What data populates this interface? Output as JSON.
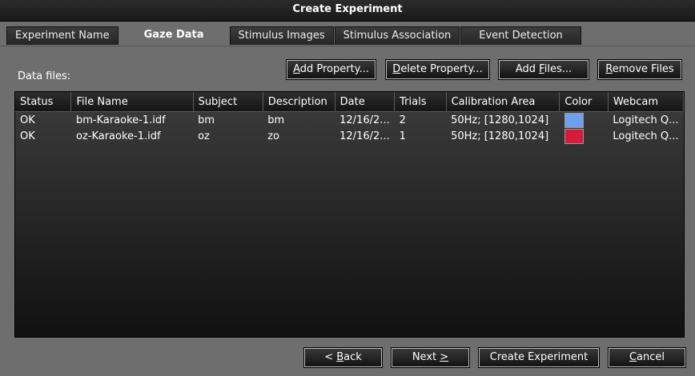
{
  "window": {
    "title": "Create Experiment"
  },
  "tabs": [
    {
      "label": "Experiment Name",
      "active": false
    },
    {
      "label": "Gaze Data",
      "active": true
    },
    {
      "label": "Stimulus Images",
      "active": false
    },
    {
      "label": "Stimulus Association",
      "active": false
    },
    {
      "label": "Event Detection",
      "active": false
    }
  ],
  "toolbar": {
    "add_property": {
      "u": "A",
      "rest": "dd Property..."
    },
    "delete_property": {
      "u": "D",
      "rest": "elete Property..."
    },
    "add_files": {
      "pre": "Add ",
      "u": "F",
      "rest": "iles..."
    },
    "remove_files": {
      "u": "R",
      "rest": "emove Files"
    }
  },
  "data_files_label": "Data files:",
  "table": {
    "columns": [
      "Status",
      "File Name",
      "Subject",
      "Description",
      "Date",
      "Trials",
      "Calibration Area",
      "Color",
      "Webcam"
    ],
    "rows": [
      {
        "status": "OK",
        "file_name": "bm-Karaoke-1.idf",
        "subject": "bm",
        "description": "bm",
        "date": "12/16/2...",
        "trials": "2",
        "calibration": "50Hz; [1280,1024]",
        "color": "#6f9ff0",
        "webcam": "Logitech Q..."
      },
      {
        "status": "OK",
        "file_name": "oz-Karaoke-1.idf",
        "subject": "oz",
        "description": "zo",
        "date": "12/16/2...",
        "trials": "1",
        "calibration": "50Hz; [1280,1024]",
        "color": "#d61c3a",
        "webcam": "Logitech Q..."
      }
    ]
  },
  "footer": {
    "back": {
      "pre": "< ",
      "u": "B",
      "rest": "ack"
    },
    "next": {
      "pre": "Next ",
      "u": ">",
      "rest": ""
    },
    "create": "Create Experiment",
    "cancel": {
      "u": "C",
      "rest": "ancel"
    }
  }
}
